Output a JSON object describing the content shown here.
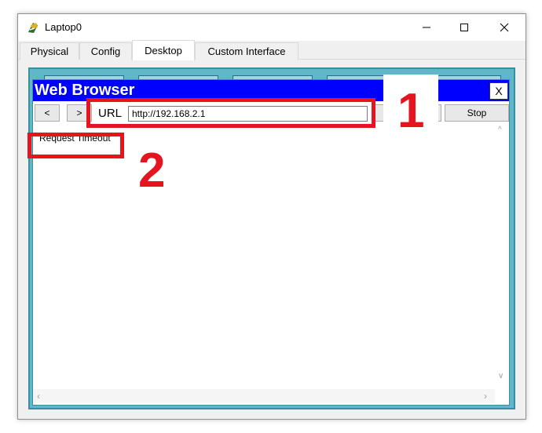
{
  "window": {
    "title": "Laptop0",
    "controls": {
      "minimize_icon": "minimize-icon",
      "maximize_icon": "maximize-icon",
      "close_icon": "close-icon"
    }
  },
  "tabs": [
    {
      "label": "Physical",
      "active": false
    },
    {
      "label": "Config",
      "active": false
    },
    {
      "label": "Desktop",
      "active": true
    },
    {
      "label": "Custom Interface",
      "active": false
    }
  ],
  "browser": {
    "title": "Web Browser",
    "close_label": "X",
    "back_label": "<",
    "forward_label": ">",
    "url_label": "URL",
    "url_value": "http://192.168.2.1",
    "stop_label": "Stop",
    "status": "Request Timeout"
  },
  "annotations": [
    {
      "number": "1",
      "target": "url-bar"
    },
    {
      "number": "2",
      "target": "request-timeout"
    }
  ],
  "colors": {
    "browser_titlebar": "#0000ff",
    "frame": "#5fb7c9",
    "annotation": "#e6141f"
  }
}
